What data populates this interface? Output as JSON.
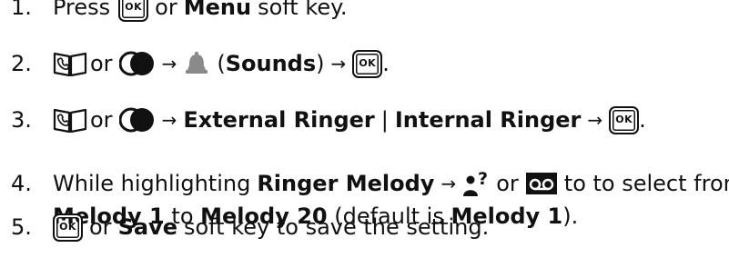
{
  "steps": [
    {
      "number": "1.",
      "ok_key": "OK",
      "text_or": "or",
      "bold_menu": "Menu",
      "text_soft_key": "soft key."
    },
    {
      "number": "2.",
      "text_or": "or",
      "arrow": "→",
      "open_paren": "(",
      "bold_sounds": "Sounds",
      "close_paren": ")",
      "ok_key": "OK",
      "end": "."
    },
    {
      "number": "3.",
      "text_or": "or",
      "arrow": "→",
      "bold_external": "External Ringer",
      "pipe": "|",
      "bold_internal": "Internal Ringer",
      "ok_key": "OK",
      "end": "."
    },
    {
      "number": "4.",
      "text_while": "While highlighting",
      "bold_ringer_melody": "Ringer Melody",
      "arrow": "→",
      "text_or": "or",
      "text_to_select": "to to select from",
      "bold_melody1": "Melody 1",
      "text_to": "to",
      "bold_melody20": "Melody 20",
      "text_default": "(default is",
      "bold_default_melody": "Melody 1",
      "text_close": ")."
    },
    {
      "number": "5.",
      "ok_key": "OK",
      "text_or": "or",
      "bold_save": "Save",
      "text_rest": "soft key to save the setting."
    }
  ],
  "icons": {
    "directory": "phonebook-icon",
    "toggle": "call-log-icon",
    "bell": "bell-icon",
    "person_question": "caller-id-icon",
    "voicemail": "voicemail-icon"
  }
}
